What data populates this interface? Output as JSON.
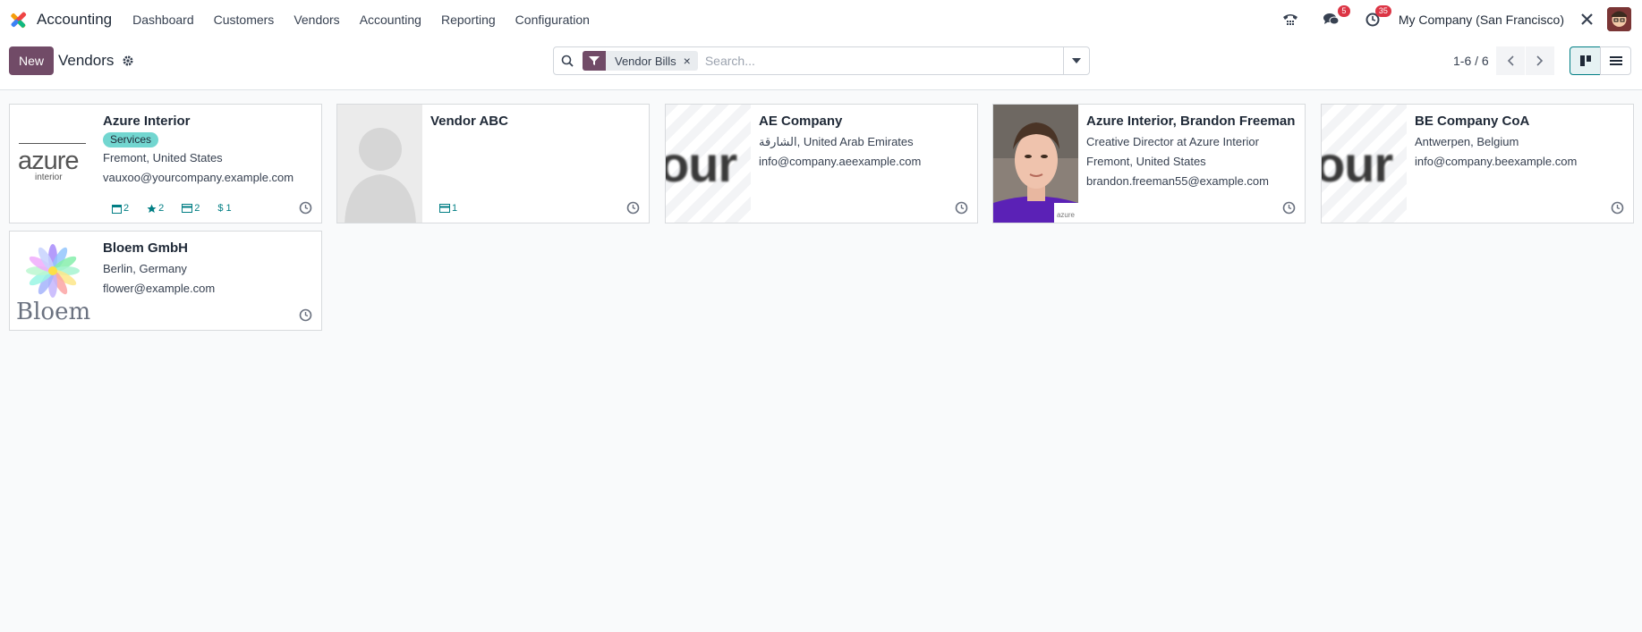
{
  "nav": {
    "app_name": "Accounting",
    "menu": [
      "Dashboard",
      "Customers",
      "Vendors",
      "Accounting",
      "Reporting",
      "Configuration"
    ],
    "messages_badge": "5",
    "activities_badge": "35",
    "company": "My Company (San Francisco)"
  },
  "control": {
    "new_label": "New",
    "title": "Vendors",
    "facet_label": "Vendor Bills",
    "search_placeholder": "Search...",
    "pager": "1-6 / 6"
  },
  "cards": [
    {
      "name": "Azure Interior",
      "tag": "Services",
      "lines": [
        "Fremont, United States",
        "vauxoo@yourcompany.example.com"
      ],
      "logo_text": "azure",
      "logo_sub": "interior",
      "stats": {
        "meetings": "2",
        "favorites": "2",
        "bills": "2",
        "money": "1"
      }
    },
    {
      "name": "Vendor ABC",
      "stats": {
        "bills": "1"
      }
    },
    {
      "name": "AE Company",
      "lines": [
        "الشارقة, United Arab Emirates",
        "info@company.aeexample.com"
      ],
      "placeholder_text": "our"
    },
    {
      "name": "Azure Interior, Brandon Freeman",
      "lines": [
        "Creative Director at Azure Interior",
        "Fremont, United States",
        "brandon.freeman55@example.com"
      ]
    },
    {
      "name": "BE Company CoA",
      "lines": [
        "Antwerpen, Belgium",
        "info@company.beexample.com"
      ],
      "placeholder_text": "our"
    },
    {
      "name": "Bloem GmbH",
      "lines": [
        "Berlin, Germany",
        "flower@example.com"
      ],
      "logo_text": "Bloem"
    }
  ],
  "colors": {
    "brand": "#714b67",
    "accent": "#017e84",
    "tag": "#72d6d0",
    "badge": "#dc3545"
  }
}
